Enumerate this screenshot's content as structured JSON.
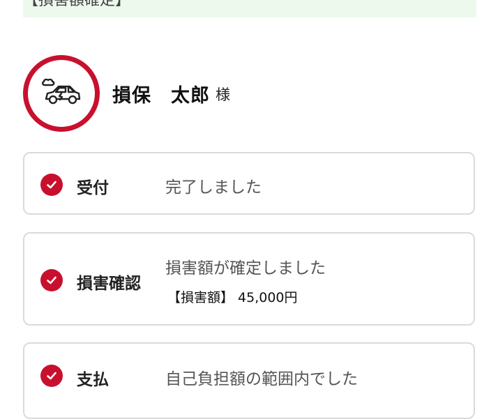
{
  "banner": {
    "text": "【損害額確定】"
  },
  "customer": {
    "name": "損保　太郎",
    "honorific": "様",
    "avatar_icon": "car-accident-icon"
  },
  "steps": [
    {
      "label": "受付",
      "status": "完了しました",
      "icon": "check-circle-icon"
    },
    {
      "label": "損害確認",
      "status": "損害額が確定しました",
      "detail": "【損害額】 45,000円",
      "icon": "check-circle-icon"
    },
    {
      "label": "支払",
      "status": "自己負担額の範囲内でした",
      "icon": "check-circle-icon"
    }
  ],
  "colors": {
    "accent": "#c8102e",
    "banner_bg": "#eef9ee",
    "card_border": "#d7dbe0"
  }
}
